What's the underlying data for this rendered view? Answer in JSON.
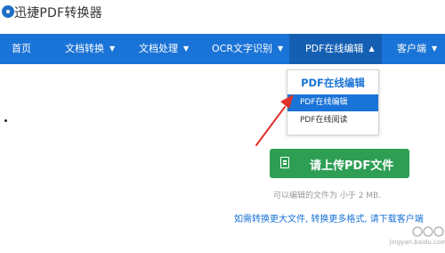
{
  "app": {
    "title": "迅捷PDF转换器"
  },
  "nav": {
    "items": [
      {
        "label": "首页",
        "has_dropdown": false
      },
      {
        "label": "文档转换",
        "has_dropdown": true
      },
      {
        "label": "文档处理",
        "has_dropdown": true
      },
      {
        "label": "OCR文字识别",
        "has_dropdown": true
      },
      {
        "label": "PDF在线编辑",
        "has_dropdown": true,
        "active": true
      },
      {
        "label": "客户端",
        "has_dropdown": true
      }
    ]
  },
  "dropdown": {
    "heading": "PDF在线编辑",
    "items": [
      {
        "label": "PDF在线编辑",
        "selected": true
      },
      {
        "label": "PDF在线阅读",
        "selected": false
      }
    ]
  },
  "upload": {
    "button_label": "请上传PDF文件",
    "size_note": "可以编辑的文件为 小于 2 MB.",
    "client_note": "如需转换更大文件, 转换更多格式, 请下载客户端"
  },
  "watermark": {
    "text": "jingyan.baidu.com"
  },
  "colors": {
    "nav_bg": "#1a73d6",
    "button_green": "#2e9e55",
    "annotation_red": "#e0302a"
  }
}
